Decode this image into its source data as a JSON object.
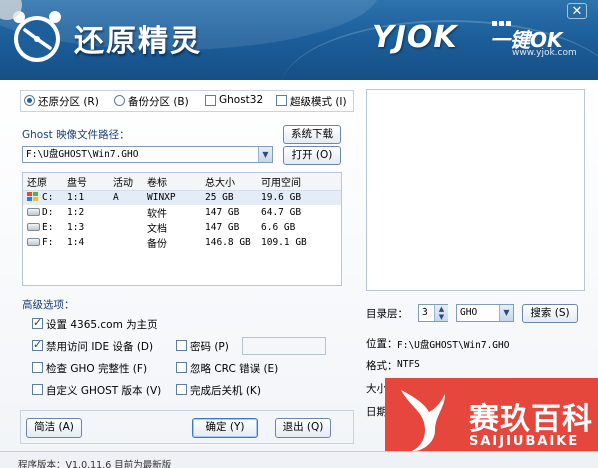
{
  "window": {
    "title": "还原精灵",
    "close_icon": "✕",
    "brand_name": "YJOK",
    "brand_suffix": "一键OK",
    "brand_url": "www.yjok.com"
  },
  "mode": {
    "restore_label": "还原分区 (R)",
    "backup_label": "备份分区 (B)",
    "ghost32_label": "Ghost32",
    "super_label": "超级模式 (I)",
    "restore_selected": true
  },
  "image_path": {
    "label": "Ghost 映像文件路径：",
    "value": "F:\\U盘GHOST\\Win7.GHO",
    "download_button": "系统下载",
    "open_button": "打开 (O)"
  },
  "partition_table": {
    "columns": [
      "还原",
      "盘号",
      "活动",
      "卷标",
      "总大小",
      "可用空间"
    ],
    "rows": [
      {
        "drive": "C:",
        "disk": "1:1",
        "active": "A",
        "label": "WINXP",
        "total": "25 GB",
        "free": "19.6 GB",
        "icon": "windows-drive-icon"
      },
      {
        "drive": "D:",
        "disk": "1:2",
        "active": "",
        "label": "软件",
        "total": "147 GB",
        "free": "64.7 GB",
        "icon": "hard-drive-icon"
      },
      {
        "drive": "E:",
        "disk": "1:3",
        "active": "",
        "label": "文档",
        "total": "147 GB",
        "free": "6.6 GB",
        "icon": "hard-drive-icon"
      },
      {
        "drive": "F:",
        "disk": "1:4",
        "active": "",
        "label": "备份",
        "total": "146.8 GB",
        "free": "109.1 GB",
        "icon": "hard-drive-icon"
      }
    ]
  },
  "advanced": {
    "title": "高级选项：",
    "homepage_label": "设置 4365.com 为主页",
    "homepage_checked": true,
    "disable_ide_label": "禁用访问 IDE 设备 (D)",
    "disable_ide_checked": true,
    "password_label": "密码 (P)",
    "password_checked": false,
    "password_value": "",
    "check_gho_label": "检查 GHO 完整性 (F)",
    "check_gho_checked": false,
    "ignore_crc_label": "忽略 CRC 错误 (E)",
    "ignore_crc_checked": false,
    "custom_ghost_label": "自定义 GHOST 版本 (V)",
    "custom_ghost_checked": false,
    "shutdown_label": "完成后关机 (K)",
    "shutdown_checked": false
  },
  "buttons": {
    "simple": "简洁 (A)",
    "ok": "确定 (Y)",
    "exit": "退出 (Q)",
    "search": "搜索 (S)"
  },
  "right_panel": {
    "dir_level_label": "目录层：",
    "dir_level_value": "3",
    "ext_value": "GHO",
    "location_label": "位置：",
    "location_value": "F:\\U盘GHOST\\Win7.GHO",
    "format_label": "格式：",
    "format_value": "NTFS",
    "size_label": "大小",
    "date_label": "日期"
  },
  "watermark": {
    "title": "赛玖百科",
    "subtitle": "SAIJIUBAIKE",
    "color": "#e5473d"
  },
  "status": {
    "text": "程序版本：V1.0.11.6  目前为最新版"
  }
}
